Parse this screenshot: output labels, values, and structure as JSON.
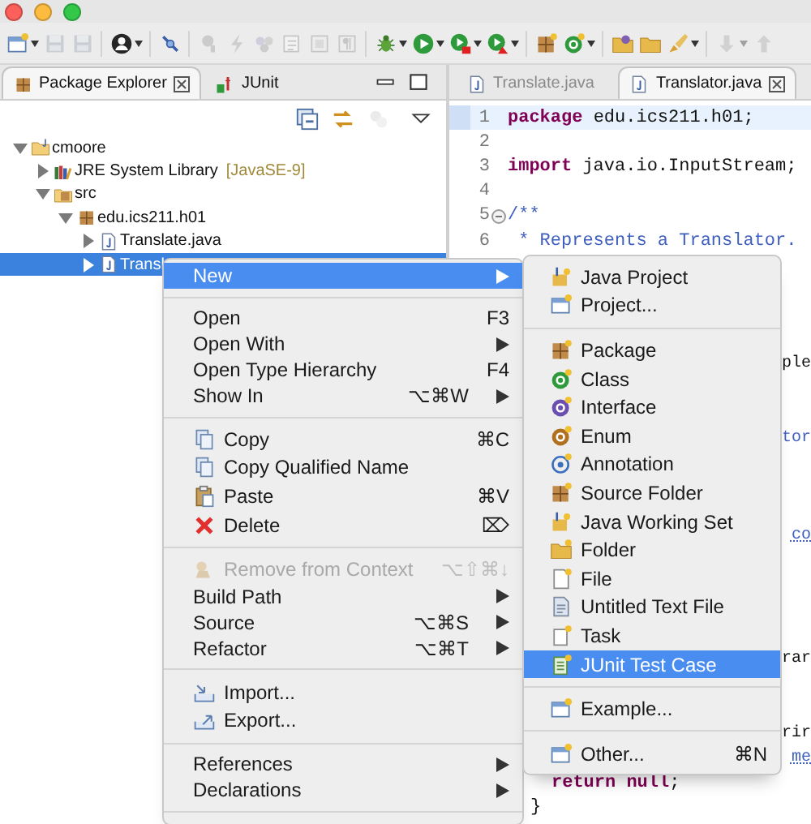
{
  "toolbar": [
    {
      "kind": "new",
      "disabled": false,
      "dropdown": true
    },
    {
      "kind": "save",
      "disabled": true,
      "dropdown": false
    },
    {
      "kind": "saveall",
      "disabled": true,
      "dropdown": false
    },
    {
      "kind": "separator"
    },
    {
      "kind": "profile",
      "disabled": false,
      "dropdown": true
    },
    {
      "kind": "separator"
    },
    {
      "kind": "pin",
      "disabled": false,
      "dropdown": false
    },
    {
      "kind": "separator"
    },
    {
      "kind": "lamp",
      "disabled": true,
      "dropdown": false
    },
    {
      "kind": "lightning",
      "disabled": true,
      "dropdown": false
    },
    {
      "kind": "dots",
      "disabled": true,
      "dropdown": false
    },
    {
      "kind": "doc",
      "disabled": true,
      "dropdown": false
    },
    {
      "kind": "frame",
      "disabled": true,
      "dropdown": false
    },
    {
      "kind": "pilcrow",
      "disabled": true,
      "dropdown": false
    },
    {
      "kind": "separator"
    },
    {
      "kind": "debug",
      "disabled": false,
      "dropdown": true
    },
    {
      "kind": "run",
      "disabled": false,
      "dropdown": true
    },
    {
      "kind": "runext",
      "disabled": false,
      "dropdown": true
    },
    {
      "kind": "coverage",
      "disabled": false,
      "dropdown": true
    },
    {
      "kind": "separator"
    },
    {
      "kind": "package",
      "disabled": false,
      "dropdown": false
    },
    {
      "kind": "newclass",
      "disabled": false,
      "dropdown": true
    },
    {
      "kind": "separator"
    },
    {
      "kind": "opentype",
      "disabled": false,
      "dropdown": false
    },
    {
      "kind": "openfolder",
      "disabled": false,
      "dropdown": false
    },
    {
      "kind": "brush",
      "disabled": false,
      "dropdown": true
    },
    {
      "kind": "separator"
    },
    {
      "kind": "down",
      "disabled": true,
      "dropdown": true
    },
    {
      "kind": "up",
      "disabled": true,
      "dropdown": false
    }
  ],
  "package_explorer": {
    "tabs": [
      {
        "label": "Package Explorer",
        "selected": true,
        "closable": true
      },
      {
        "label": "JUnit",
        "selected": false,
        "closable": false
      }
    ],
    "view_toolbar": [
      {
        "kind": "collapse",
        "disabled": false
      },
      {
        "kind": "link",
        "disabled": false
      },
      {
        "kind": "filter",
        "disabled": true
      },
      {
        "kind": "menu",
        "disabled": false
      }
    ],
    "tree": [
      {
        "kind": "project",
        "label": "cmoore",
        "expanded": true,
        "selected": false,
        "children": [
          {
            "kind": "library",
            "label": "JRE System Library",
            "decoration": "[JavaSE-9]",
            "expanded": false,
            "selected": false
          },
          {
            "kind": "srcfolder",
            "label": "src",
            "expanded": true,
            "selected": false,
            "children": [
              {
                "kind": "package",
                "label": "edu.ics211.h01",
                "expanded": true,
                "selected": false,
                "children": [
                  {
                    "kind": "javafile",
                    "label": "Translate.java",
                    "expanded": false,
                    "selected": false
                  },
                  {
                    "kind": "javafile",
                    "label": "Transl",
                    "expanded": false,
                    "selected": true
                  }
                ]
              }
            ]
          }
        ]
      }
    ]
  },
  "editor": {
    "tabs": [
      {
        "label": "Translate.java",
        "selected": false,
        "closable": false
      },
      {
        "label": "Translator.java",
        "selected": true,
        "closable": true
      }
    ],
    "lines": [
      {
        "number": "1",
        "current": true,
        "tokens": [
          {
            "kind": "keyword",
            "text": "package"
          },
          {
            "kind": "plain",
            "text": " edu.ics211.h01;"
          }
        ]
      },
      {
        "number": "2",
        "current": false
      },
      {
        "number": "3",
        "current": false,
        "tokens": [
          {
            "kind": "keyword",
            "text": "import"
          },
          {
            "kind": "plain",
            "text": " java.io.InputStream;"
          }
        ]
      },
      {
        "number": "4",
        "current": false
      },
      {
        "number": "5",
        "current": false,
        "fold_expanded": true,
        "tokens": [
          {
            "kind": "doc",
            "text": "/**"
          }
        ]
      },
      {
        "number": "6",
        "current": false,
        "tokens": [
          {
            "kind": "doc",
            "text": " * Represents a Translator."
          }
        ]
      }
    ],
    "fragments": [
      {
        "tokens": [
          {
            "kind": "plain",
            "text": "ple"
          }
        ]
      },
      {
        "tokens": [
          {
            "kind": "doc",
            "text": "tor"
          }
        ]
      },
      {
        "tokens": [
          {
            "kind": "link",
            "text": "co"
          }
        ]
      },
      {
        "tokens": [
          {
            "kind": "plain",
            "text": "rar"
          }
        ]
      },
      {
        "tokens": [
          {
            "kind": "plain",
            "text": "rir"
          }
        ]
      },
      {
        "tokens": [
          {
            "kind": "link",
            "text": "me"
          }
        ]
      },
      {
        "tokens": [
          {
            "kind": "keyword",
            "text": "return"
          },
          {
            "kind": "keyword",
            "text": " null"
          },
          {
            "kind": "plain",
            "text": ";"
          }
        ]
      },
      {
        "tokens": [
          {
            "kind": "plain",
            "text": "}"
          }
        ]
      }
    ]
  },
  "context_menu": {
    "items": [
      {
        "kind": "item",
        "label": "New",
        "submenu": true,
        "selected": true,
        "disabled": false
      },
      {
        "kind": "separator"
      },
      {
        "kind": "item",
        "label": "Open",
        "shortcut": "F3",
        "submenu": false,
        "selected": false,
        "disabled": false
      },
      {
        "kind": "item",
        "label": "Open With",
        "submenu": true,
        "selected": false,
        "disabled": false
      },
      {
        "kind": "item",
        "label": "Open Type Hierarchy",
        "shortcut": "F4",
        "submenu": false,
        "selected": false,
        "disabled": false
      },
      {
        "kind": "item",
        "label": "Show In",
        "shortcut": "⌥⌘W",
        "submenu": true,
        "selected": false,
        "disabled": false
      },
      {
        "kind": "separator"
      },
      {
        "kind": "item",
        "label": "Copy",
        "shortcut": "⌘C",
        "submenu": false,
        "selected": false,
        "disabled": false
      },
      {
        "kind": "item",
        "label": "Copy Qualified Name",
        "submenu": false,
        "selected": false,
        "disabled": false
      },
      {
        "kind": "item",
        "label": "Paste",
        "shortcut": "⌘V",
        "submenu": false,
        "selected": false,
        "disabled": false
      },
      {
        "kind": "item",
        "label": "Delete",
        "shortcut": "⌦",
        "submenu": false,
        "selected": false,
        "disabled": false
      },
      {
        "kind": "separator"
      },
      {
        "kind": "item",
        "label": "Remove from Context",
        "shortcut": "⌥⇧⌘↓",
        "submenu": false,
        "selected": false,
        "disabled": true
      },
      {
        "kind": "item",
        "label": "Build Path",
        "submenu": true,
        "selected": false,
        "disabled": false
      },
      {
        "kind": "item",
        "label": "Source",
        "shortcut": "⌥⌘S",
        "submenu": true,
        "selected": false,
        "disabled": false
      },
      {
        "kind": "item",
        "label": "Refactor",
        "shortcut": "⌥⌘T",
        "submenu": true,
        "selected": false,
        "disabled": false
      },
      {
        "kind": "separator"
      },
      {
        "kind": "item",
        "label": "Import...",
        "submenu": false,
        "selected": false,
        "disabled": false
      },
      {
        "kind": "item",
        "label": "Export...",
        "submenu": false,
        "selected": false,
        "disabled": false
      },
      {
        "kind": "separator"
      },
      {
        "kind": "item",
        "label": "References",
        "submenu": true,
        "selected": false,
        "disabled": false
      },
      {
        "kind": "item",
        "label": "Declarations",
        "submenu": true,
        "selected": false,
        "disabled": false
      },
      {
        "kind": "separator"
      }
    ]
  },
  "submenu": {
    "items": [
      {
        "kind": "item",
        "label": "Java Project",
        "submenu": false,
        "selected": false,
        "disabled": false
      },
      {
        "kind": "item",
        "label": "Project...",
        "submenu": false,
        "selected": false,
        "disabled": false
      },
      {
        "kind": "separator"
      },
      {
        "kind": "item",
        "label": "Package",
        "submenu": false,
        "selected": false,
        "disabled": false
      },
      {
        "kind": "item",
        "label": "Class",
        "submenu": false,
        "selected": false,
        "disabled": false
      },
      {
        "kind": "item",
        "label": "Interface",
        "submenu": false,
        "selected": false,
        "disabled": false
      },
      {
        "kind": "item",
        "label": "Enum",
        "submenu": false,
        "selected": false,
        "disabled": false
      },
      {
        "kind": "item",
        "label": "Annotation",
        "submenu": false,
        "selected": false,
        "disabled": false
      },
      {
        "kind": "item",
        "label": "Source Folder",
        "submenu": false,
        "selected": false,
        "disabled": false
      },
      {
        "kind": "item",
        "label": "Java Working Set",
        "submenu": false,
        "selected": false,
        "disabled": false
      },
      {
        "kind": "item",
        "label": "Folder",
        "submenu": false,
        "selected": false,
        "disabled": false
      },
      {
        "kind": "item",
        "label": "File",
        "submenu": false,
        "selected": false,
        "disabled": false
      },
      {
        "kind": "item",
        "label": "Untitled Text File",
        "submenu": false,
        "selected": false,
        "disabled": false
      },
      {
        "kind": "item",
        "label": "Task",
        "submenu": false,
        "selected": false,
        "disabled": false
      },
      {
        "kind": "item",
        "label": "JUnit Test Case",
        "submenu": false,
        "selected": true,
        "disabled": false
      },
      {
        "kind": "separator"
      },
      {
        "kind": "item",
        "label": "Example...",
        "submenu": false,
        "selected": false,
        "disabled": false
      },
      {
        "kind": "separator"
      },
      {
        "kind": "item",
        "label": "Other...",
        "shortcut": "⌘N",
        "submenu": false,
        "selected": false,
        "disabled": false
      }
    ]
  }
}
